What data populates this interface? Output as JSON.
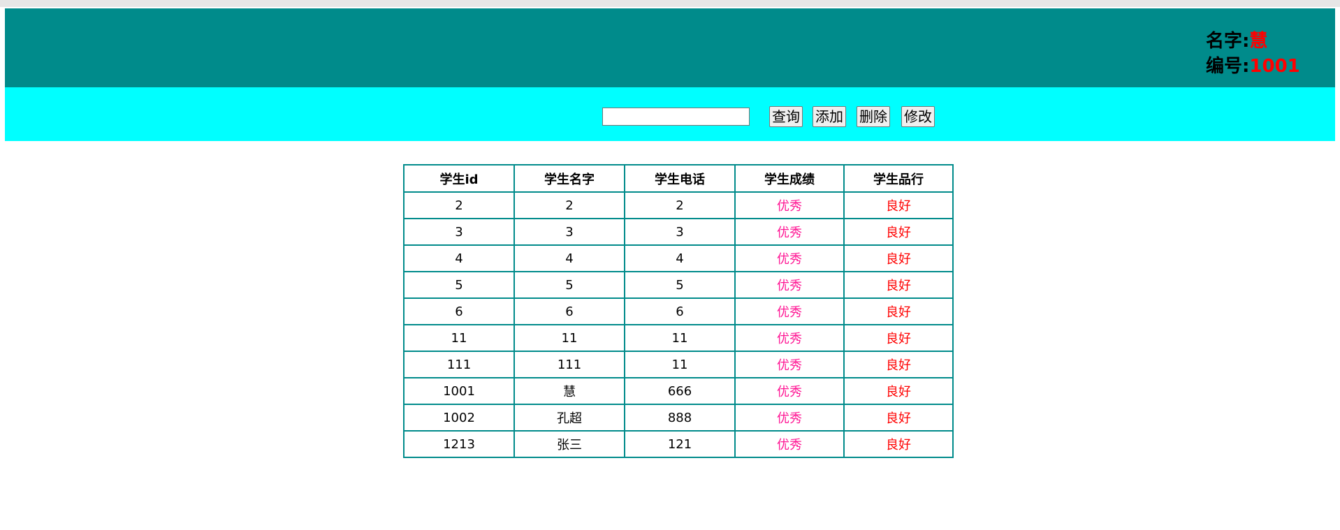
{
  "user": {
    "name_label": "名字:",
    "name_value": "慧",
    "id_label": "编号:",
    "id_value": "1001"
  },
  "toolbar": {
    "search_value": "",
    "query_label": "查询",
    "add_label": "添加",
    "delete_label": "删除",
    "edit_label": "修改"
  },
  "table": {
    "headers": [
      "学生id",
      "学生名字",
      "学生电话",
      "学生成绩",
      "学生品行"
    ],
    "rows": [
      [
        "2",
        "2",
        "2",
        "优秀",
        "良好"
      ],
      [
        "3",
        "3",
        "3",
        "优秀",
        "良好"
      ],
      [
        "4",
        "4",
        "4",
        "优秀",
        "良好"
      ],
      [
        "5",
        "5",
        "5",
        "优秀",
        "良好"
      ],
      [
        "6",
        "6",
        "6",
        "优秀",
        "良好"
      ],
      [
        "11",
        "11",
        "11",
        "优秀",
        "良好"
      ],
      [
        "111",
        "111",
        "11",
        "优秀",
        "良好"
      ],
      [
        "1001",
        "慧",
        "666",
        "优秀",
        "良好"
      ],
      [
        "1002",
        "孔超",
        "888",
        "优秀",
        "良好"
      ],
      [
        "1213",
        "张三",
        "121",
        "优秀",
        "良好"
      ]
    ]
  },
  "colors": {
    "header_bg": "#008b8b",
    "toolbar_bg": "#00ffff",
    "table_border": "#008b8b",
    "highlight_red": "#ff0000",
    "grade_pink": "#ff1493"
  }
}
